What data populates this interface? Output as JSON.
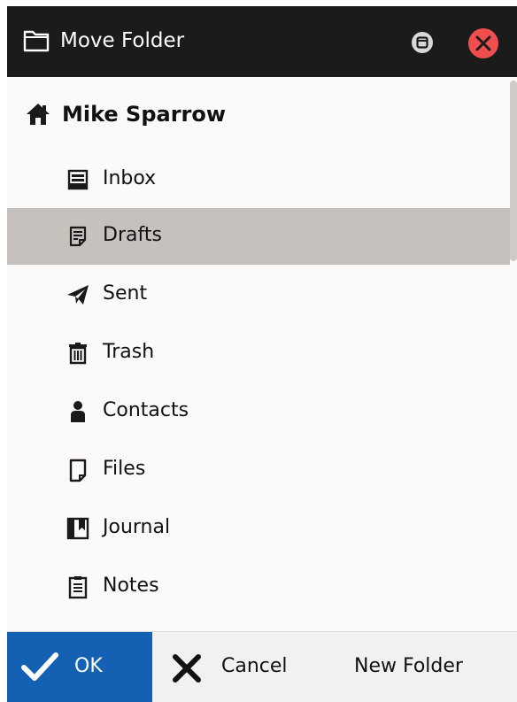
{
  "window": {
    "title": "Move Folder",
    "icon": "folder-icon",
    "controls": [
      "restore-icon",
      "close-icon"
    ],
    "close_color": "#f04e4e"
  },
  "tree": {
    "account": {
      "label": "Mike Sparrow",
      "icon": "home-icon"
    },
    "items": [
      {
        "label": "Inbox",
        "icon": "inbox-icon"
      },
      {
        "label": "Drafts",
        "icon": "drafts-icon",
        "selected": true
      },
      {
        "label": "Sent",
        "icon": "paper-plane-icon"
      },
      {
        "label": "Trash",
        "icon": "trash-icon"
      },
      {
        "label": "Contacts",
        "icon": "person-icon"
      },
      {
        "label": "Files",
        "icon": "file-icon"
      },
      {
        "label": "Journal",
        "icon": "journal-icon"
      },
      {
        "label": "Notes",
        "icon": "notes-icon"
      }
    ]
  },
  "footer": {
    "ok_label": "OK",
    "cancel_label": "Cancel",
    "new_folder_label": "New Folder"
  },
  "colors": {
    "titlebar_bg": "#1b1b1b",
    "selected_row_bg": "#c7c1be",
    "ok_button_bg": "#1461b3"
  }
}
